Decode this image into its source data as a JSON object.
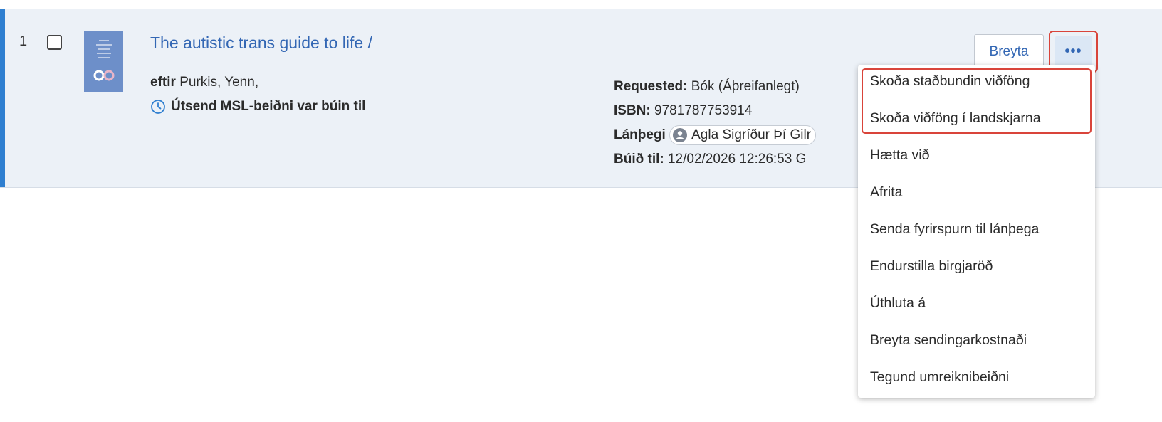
{
  "request": {
    "row_number": "1",
    "title": "The autistic trans guide to life /",
    "author_prefix": "eftir",
    "author": "Purkis, Yenn,",
    "status": "Útsend MSL-beiðni var búin til",
    "requested_label": "Requested:",
    "requested_value": "Bók (Áþreifanlegt)",
    "isbn_label": "ISBN:",
    "isbn_value": "9781787753914",
    "patron_label": "Lánþegi",
    "patron_name": "Agla Sigríður Þí Gilr",
    "created_label": "Búið til:",
    "created_value": "12/02/2026 12:26:53 G"
  },
  "actions": {
    "edit_label": "Breyta",
    "more_label": "•••"
  },
  "menu": {
    "items": [
      "Skoða staðbundin viðföng",
      "Skoða viðföng í landskjarna",
      "Hætta við",
      "Afrita",
      "Senda fyrirspurn til lánþega",
      "Endurstilla birgjaröð",
      "Úthluta á",
      "Breyta sendingarkostnaði",
      "Tegund umreiknibeiðni"
    ]
  },
  "colors": {
    "accent": "#2f7fd0",
    "link": "#3367b4",
    "highlight": "#d9443a",
    "row_background": "#ecf1f7"
  },
  "icons": {
    "status": "clock-icon",
    "patron": "person-icon",
    "more": "ellipsis-icon"
  }
}
